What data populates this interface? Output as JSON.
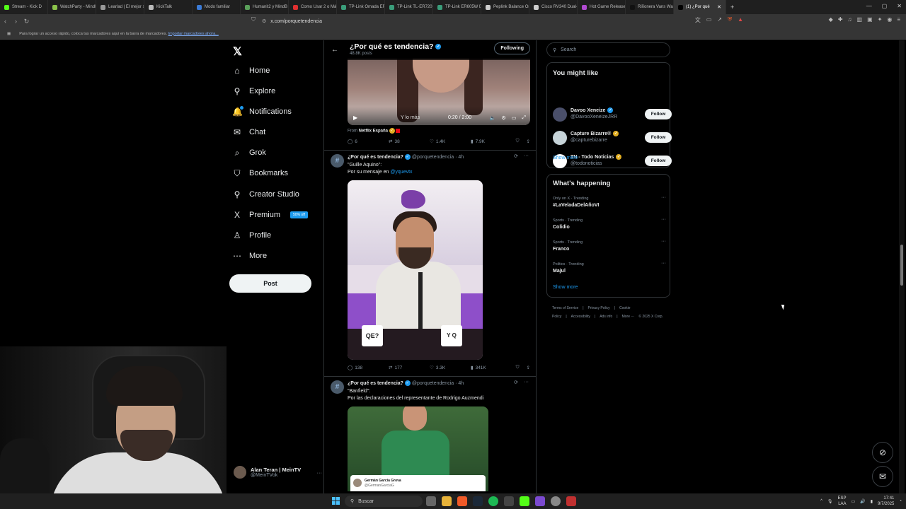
{
  "browser": {
    "tabs": [
      {
        "label": "Stream - Kick D",
        "color": "#53fc18"
      },
      {
        "label": "WatchParty - MindF",
        "color": "#8bc34a"
      },
      {
        "label": "Learlad | El mejor s",
        "color": "#999999"
      },
      {
        "label": "KickTalk",
        "color": "#bbbbbb"
      },
      {
        "label": "Modo familiar",
        "color": "#3b7bd6"
      },
      {
        "label": "Humanit2 y MindB",
        "color": "#5aa05a"
      },
      {
        "label": "Como Usar 2 o Má",
        "color": "#e03030"
      },
      {
        "label": "TP-Link Omada ER",
        "color": "#3a9d7a"
      },
      {
        "label": "TP-Link TL-ER7206",
        "color": "#3a9d7a"
      },
      {
        "label": "TP-Link ER605W D",
        "color": "#3a9d7a"
      },
      {
        "label": "Peplink Balance One",
        "color": "#cccccc"
      },
      {
        "label": "Cisco RV340 Dual-W",
        "color": "#cccccc"
      },
      {
        "label": "Hot Game Releases",
        "color": "#b04ad0"
      },
      {
        "label": "Riñonera Vans Was",
        "color": "#111111"
      },
      {
        "label": "(1) ¿Por qué",
        "color": "#000000"
      }
    ],
    "new_tab": "+",
    "url": "x.com/porquetendencia",
    "bookmarks_hint": "Para lograr un acceso rápido, coloca tus marcadores aquí en la barra de marcadores.",
    "import_link": "Importar marcadores ahora..."
  },
  "nav": {
    "items": [
      {
        "label": "Home",
        "icon": "⌂"
      },
      {
        "label": "Explore",
        "icon": "⚲"
      },
      {
        "label": "Notifications",
        "icon": "🔔"
      },
      {
        "label": "Chat",
        "icon": "✉"
      },
      {
        "label": "Grok",
        "icon": "⌕"
      },
      {
        "label": "Bookmarks",
        "icon": "⛉"
      },
      {
        "label": "Creator Studio",
        "icon": "⚲"
      },
      {
        "label": "Premium",
        "icon": "X"
      },
      {
        "label": "Profile",
        "icon": "♙"
      },
      {
        "label": "More",
        "icon": "⋯"
      }
    ],
    "premium_badge": "50% off",
    "post_label": "Post",
    "account_name": "Alan Teran | MeinTV",
    "account_handle": "@MeinTVok"
  },
  "header": {
    "title": "¿Por qué es tendencia?",
    "subtitle": "48.8K posts",
    "following": "Following"
  },
  "video": {
    "caption": "Y lo más",
    "time": "0:20 / 2:00",
    "from_prefix": "From",
    "from_name": "Netflix España"
  },
  "tweets": [
    {
      "actions": {
        "replies": "6",
        "retweets": "38",
        "likes": "1.4K",
        "views": "7.9K"
      }
    },
    {
      "name": "¿Por qué es tendencia?",
      "handle": "@porquetendencia",
      "time": "· 4h",
      "line1": "\"Guille Aquino\":",
      "line2_prefix": "Por su mensaje en ",
      "line2_link": "@yquevtx",
      "mug_left": "QE?",
      "mug_right": "Y Q",
      "actions": {
        "replies": "138",
        "retweets": "177",
        "likes": "3.3K",
        "views": "341K"
      }
    },
    {
      "name": "¿Por qué es tendencia?",
      "handle": "@porquetendencia",
      "time": "· 4h",
      "line1": "\"Banfield\":",
      "line2": "Por las declaraciones del representante de Rodrigo Auzmendi",
      "card_name": "Germán García Grova",
      "card_handle": "@GermanGarciaG"
    }
  ],
  "right": {
    "search_placeholder": "Search",
    "wtf_title": "You might like",
    "wtf": [
      {
        "name": "Davoo Xeneize",
        "handle": "@DavooXeneizeJRR",
        "color": "#4a4f6a",
        "badge": "blue"
      },
      {
        "name": "Capture Bizarre®",
        "handle": "@capturebizarre",
        "color": "#c6d3d8",
        "badge": "gold"
      },
      {
        "name": "TN - Todo Noticias",
        "handle": "@todonoticias",
        "color": "#ffffff",
        "badge": "gold"
      }
    ],
    "follow_label": "Follow",
    "show_more": "Show more",
    "happening_title": "What's happening",
    "trends": [
      {
        "context": "Only on X · Trending",
        "title": "#LaVeladaDelAñoVI"
      },
      {
        "context": "Sports · Trending",
        "title": "Colidio"
      },
      {
        "context": "Sports · Trending",
        "title": "Franco"
      },
      {
        "context": "Politics · Trending",
        "title": "Majul"
      }
    ],
    "show_more2": "Show more",
    "footer": [
      "Terms of Service",
      "|",
      "Privacy Policy",
      "|",
      "Cookie Policy",
      "|",
      "Accessibility",
      "|",
      "Ads info",
      "|",
      "More ···",
      "© 2025 X Corp."
    ]
  },
  "taskbar": {
    "search": "Buscar",
    "lang1": "ESP",
    "lang2": "LAA",
    "time": "17:41",
    "date": "9/7/2025"
  }
}
